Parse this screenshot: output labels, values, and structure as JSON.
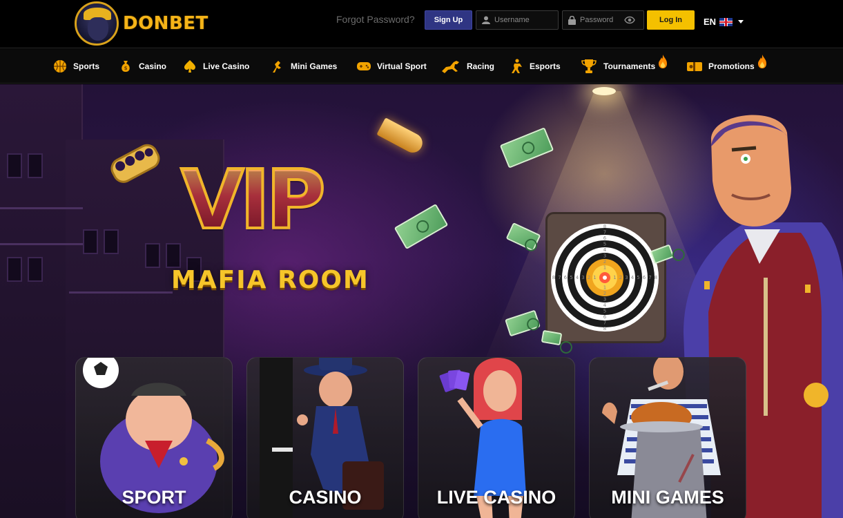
{
  "header": {
    "brand": "DONBET",
    "forgot_password": "Forgot Password?",
    "signup_label": "Sign Up",
    "username_placeholder": "Username",
    "password_placeholder": "Password",
    "login_label": "Log In",
    "language": "EN"
  },
  "nav": {
    "items": [
      {
        "label": "Sports",
        "icon": "basketball-icon"
      },
      {
        "label": "Casino",
        "icon": "money-bag-icon"
      },
      {
        "label": "Live Casino",
        "icon": "spade-icon"
      },
      {
        "label": "Mini Games",
        "icon": "mini-games-icon"
      },
      {
        "label": "Virtual Sport",
        "icon": "gamepad-icon"
      },
      {
        "label": "Racing",
        "icon": "horse-icon"
      },
      {
        "label": "Esports",
        "icon": "esports-player-icon"
      },
      {
        "label": "Tournaments",
        "icon": "trophy-icon",
        "hot": true
      },
      {
        "label": "Promotions",
        "icon": "gift-ticket-icon",
        "hot": true
      }
    ]
  },
  "hero": {
    "title": "VIP",
    "subtitle": "MAFIA ROOM",
    "target_numbers": [
      "8",
      "7",
      "6",
      "5",
      "4",
      "3",
      "2",
      "1"
    ]
  },
  "cards": [
    {
      "title": "SPORT"
    },
    {
      "title": "CASINO"
    },
    {
      "title": "LIVE CASINO"
    },
    {
      "title": "MINI GAMES"
    }
  ],
  "colors": {
    "accent": "#f4c000",
    "signup": "#2f3583",
    "brand_gold": "#f5b418",
    "fire": "#ff8a00"
  }
}
